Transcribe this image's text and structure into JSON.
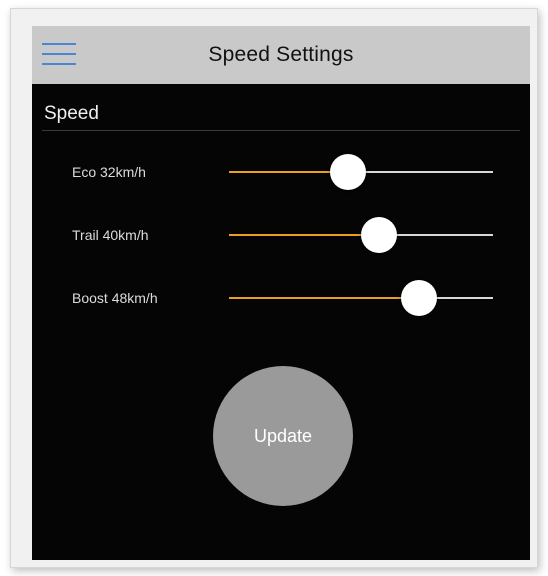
{
  "navbar": {
    "title": "Speed Settings",
    "menu_icon": "hamburger-menu-icon",
    "accent_color": "#4a86d6"
  },
  "section": {
    "title": "Speed"
  },
  "settings": [
    {
      "label": "Eco 32km/h",
      "level": 0.45
    },
    {
      "label": "Trail 40km/h",
      "level": 0.57
    },
    {
      "label": "Boost 48km/h",
      "level": 0.72
    }
  ],
  "slider_colors": {
    "fill": "#e8a020",
    "track": "#d8d8d8",
    "thumb": "#ffffff"
  },
  "update_button": {
    "label": "Update"
  }
}
